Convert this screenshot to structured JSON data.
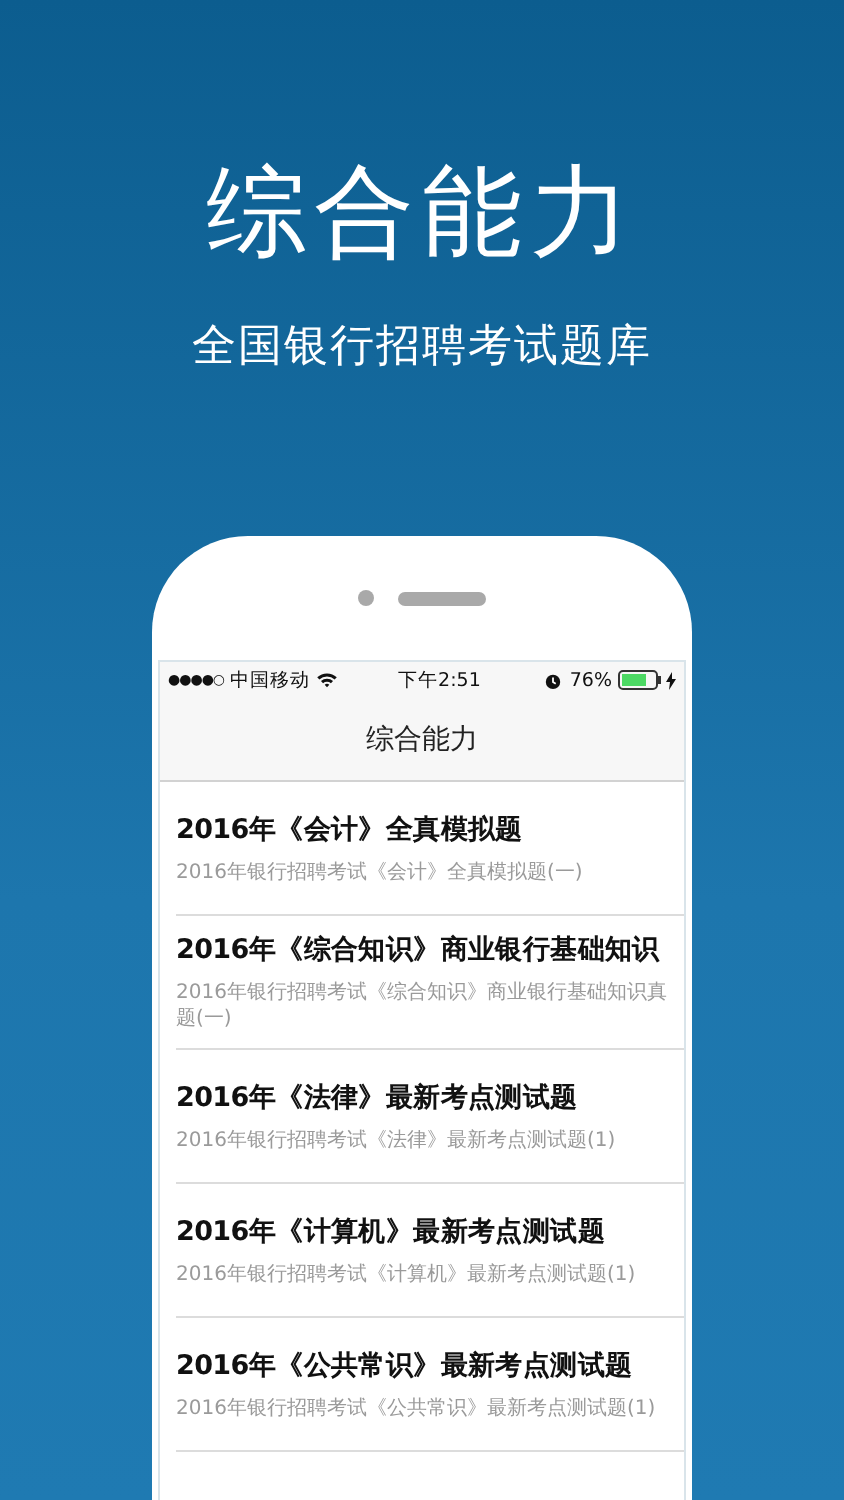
{
  "headline": {
    "title": "综合能力",
    "subtitle": "全国银行招聘考试题库"
  },
  "status_bar": {
    "signal": "●●●●○",
    "carrier": "中国移动",
    "time": "下午2:51",
    "battery": "76%"
  },
  "nav": {
    "title": "综合能力"
  },
  "items": [
    {
      "title": "2016年《会计》全真模拟题",
      "subtitle": "2016年银行招聘考试《会计》全真模拟题(一)"
    },
    {
      "title": "2016年《综合知识》商业银行基础知识",
      "subtitle": "2016年银行招聘考试《综合知识》商业银行基础知识真题(一)"
    },
    {
      "title": "2016年《法律》最新考点测试题",
      "subtitle": "2016年银行招聘考试《法律》最新考点测试题(1)"
    },
    {
      "title": "2016年《计算机》最新考点测试题",
      "subtitle": "2016年银行招聘考试《计算机》最新考点测试题(1)"
    },
    {
      "title": "2016年《公共常识》最新考点测试题",
      "subtitle": "2016年银行招聘考试《公共常识》最新考点测试题(1)"
    }
  ]
}
